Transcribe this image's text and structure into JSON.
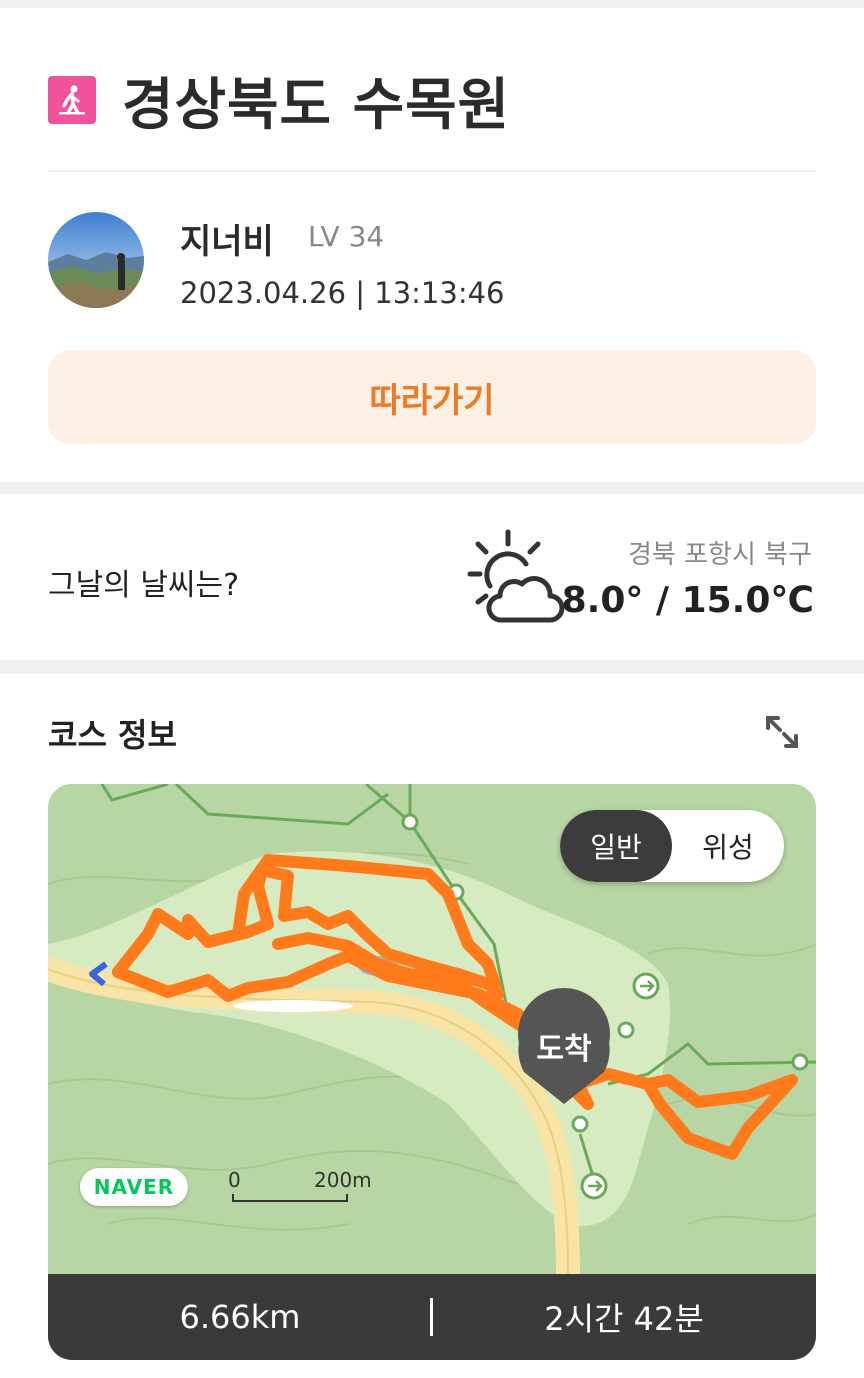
{
  "header": {
    "title": "경상북도 수목원",
    "activity_icon": "walking-person-icon",
    "accent_color": "#f0539b"
  },
  "user": {
    "name": "지너비",
    "level": "LV 34",
    "datetime": "2023.04.26 | 13:13:46"
  },
  "follow_button": {
    "label": "따라가기",
    "color": "#f07a24"
  },
  "weather": {
    "question": "그날의 날씨는?",
    "icon": "partly-cloudy-icon",
    "location": "경북 포항시 북구",
    "temperature": "8.0° / 15.0℃"
  },
  "course": {
    "title": "코스 정보",
    "expand_icon": "expand-arrows-icon",
    "map": {
      "toggle": {
        "general": "일반",
        "satellite": "위성",
        "selected": "일반"
      },
      "marker_label": "도착",
      "provider_logo": "NAVER",
      "scale": {
        "zero": "0",
        "label": "200m"
      },
      "route_color": "#ff7a1a"
    },
    "stats": {
      "distance": "6.66km",
      "duration": "2시간 42분"
    }
  }
}
